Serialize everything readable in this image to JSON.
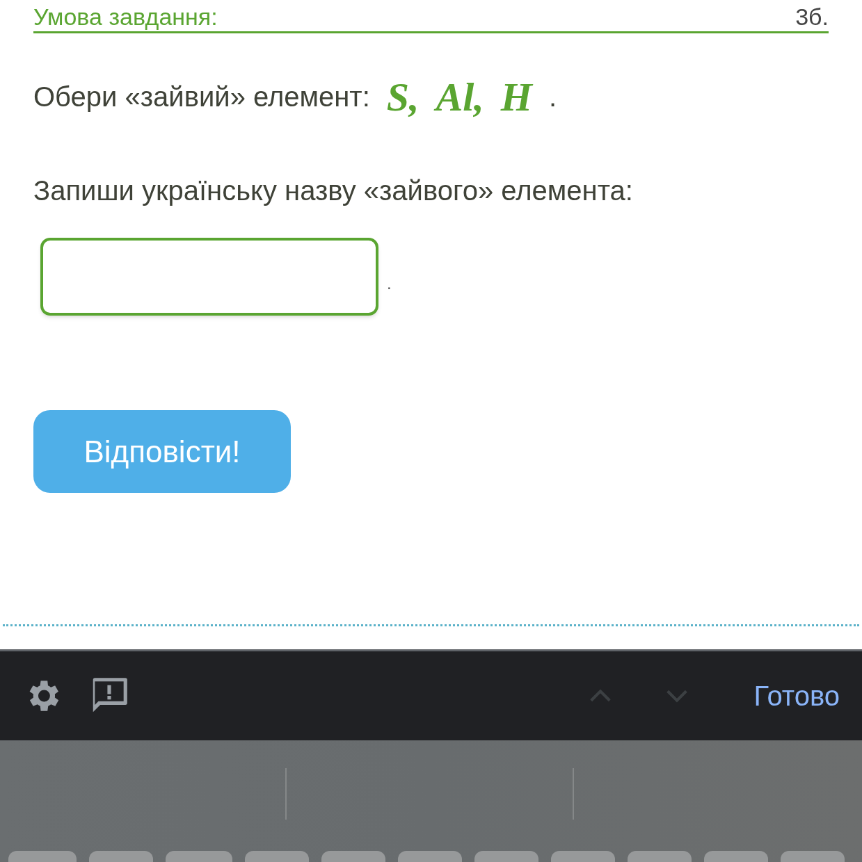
{
  "header": {
    "title": "Умова завдання:",
    "points": "3б."
  },
  "question": {
    "prompt": "Обери «зайвий» елемент:",
    "elements": [
      "S,",
      "Al,",
      "H"
    ],
    "end": "."
  },
  "instruction": "Запиши українську назву «зайвого» елемента:",
  "answer": {
    "suffix": "."
  },
  "submit_button": "Відповісти!",
  "keyboard_toolbar": {
    "nav": [
      {
        "kind": "up",
        "disabled": true
      },
      {
        "kind": "down",
        "disabled": true
      }
    ],
    "done": "Готово"
  }
}
